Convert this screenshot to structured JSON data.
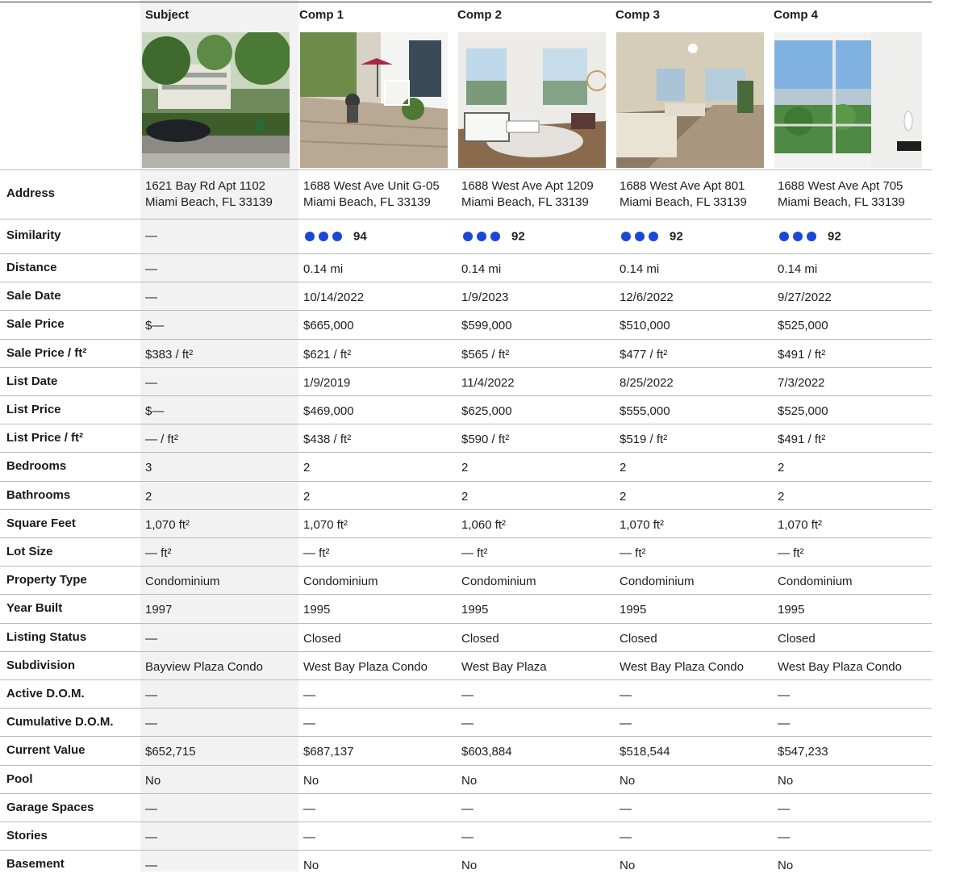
{
  "columns": [
    {
      "title": "Subject",
      "address_line1": "1621 Bay Rd Apt 1102",
      "address_line2": "Miami Beach, FL 33139",
      "photo": "street-view-photo"
    },
    {
      "title": "Comp 1",
      "address_line1": "1688 West Ave Unit G-05",
      "address_line2": "Miami Beach, FL 33139",
      "photo": "patio-photo"
    },
    {
      "title": "Comp 2",
      "address_line1": "1688 West Ave Apt 1209",
      "address_line2": "Miami Beach, FL 33139",
      "photo": "living-room-photo"
    },
    {
      "title": "Comp 3",
      "address_line1": "1688 West Ave Apt 801",
      "address_line2": "Miami Beach, FL 33139",
      "photo": "living-room-photo"
    },
    {
      "title": "Comp 4",
      "address_line1": "1688 West Ave Apt 705",
      "address_line2": "Miami Beach, FL 33139",
      "photo": "balcony-view-photo"
    }
  ],
  "address_label": "Address",
  "similarity": {
    "label": "Similarity",
    "subject": "—",
    "scores": [
      "94",
      "92",
      "92",
      "92"
    ],
    "dot_color": "#1a47d6"
  },
  "rows": [
    {
      "label": "Distance",
      "values": [
        "—",
        "0.14 mi",
        "0.14 mi",
        "0.14 mi",
        "0.14 mi"
      ]
    },
    {
      "label": "Sale Date",
      "values": [
        "—",
        "10/14/2022",
        "1/9/2023",
        "12/6/2022",
        "9/27/2022"
      ]
    },
    {
      "label": "Sale Price",
      "values": [
        "$—",
        "$665,000",
        "$599,000",
        "$510,000",
        "$525,000"
      ]
    },
    {
      "label": "Sale Price / ft²",
      "values": [
        "$383 / ft²",
        "$621 / ft²",
        "$565 / ft²",
        "$477 / ft²",
        "$491 / ft²"
      ]
    },
    {
      "label": "List Date",
      "values": [
        "—",
        "1/9/2019",
        "11/4/2022",
        "8/25/2022",
        "7/3/2022"
      ]
    },
    {
      "label": "List Price",
      "values": [
        "$—",
        "$469,000",
        "$625,000",
        "$555,000",
        "$525,000"
      ]
    },
    {
      "label": "List Price / ft²",
      "values": [
        "— / ft²",
        "$438 / ft²",
        "$590 / ft²",
        "$519 / ft²",
        "$491 / ft²"
      ]
    },
    {
      "label": "Bedrooms",
      "values": [
        "3",
        "2",
        "2",
        "2",
        "2"
      ]
    },
    {
      "label": "Bathrooms",
      "values": [
        "2",
        "2",
        "2",
        "2",
        "2"
      ]
    },
    {
      "label": "Square Feet",
      "values": [
        "1,070 ft²",
        "1,070 ft²",
        "1,060 ft²",
        "1,070 ft²",
        "1,070 ft²"
      ]
    },
    {
      "label": "Lot Size",
      "values": [
        "— ft²",
        "— ft²",
        "— ft²",
        "— ft²",
        "— ft²"
      ]
    },
    {
      "label": "Property Type",
      "values": [
        "Condominium",
        "Condominium",
        "Condominium",
        "Condominium",
        "Condominium"
      ]
    },
    {
      "label": "Year Built",
      "values": [
        "1997",
        "1995",
        "1995",
        "1995",
        "1995"
      ]
    },
    {
      "label": "Listing Status",
      "values": [
        "—",
        "Closed",
        "Closed",
        "Closed",
        "Closed"
      ]
    },
    {
      "label": "Subdivision",
      "values": [
        "Bayview Plaza Condo",
        "West Bay Plaza Condo",
        "West Bay Plaza",
        "West Bay Plaza Condo",
        "West Bay Plaza Condo"
      ]
    },
    {
      "label": "Active D.O.M.",
      "values": [
        "—",
        "—",
        "—",
        "—",
        "—"
      ]
    },
    {
      "label": "Cumulative D.O.M.",
      "values": [
        "—",
        "—",
        "—",
        "—",
        "—"
      ]
    },
    {
      "label": "Current Value",
      "values": [
        "$652,715",
        "$687,137",
        "$603,884",
        "$518,544",
        "$547,233"
      ]
    },
    {
      "label": "Pool",
      "values": [
        "No",
        "No",
        "No",
        "No",
        "No"
      ]
    },
    {
      "label": "Garage Spaces",
      "values": [
        "—",
        "—",
        "—",
        "—",
        "—"
      ]
    },
    {
      "label": "Stories",
      "values": [
        "—",
        "—",
        "—",
        "—",
        "—"
      ]
    },
    {
      "label": "Basement",
      "values": [
        "—",
        "No",
        "No",
        "No",
        "No"
      ]
    }
  ]
}
